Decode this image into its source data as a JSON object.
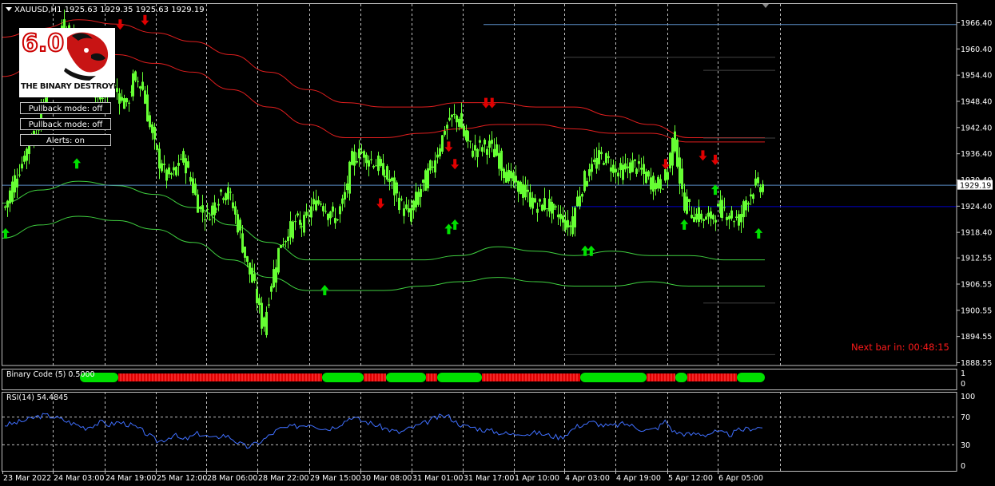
{
  "window": {
    "symbol_header": "XAUUSD,H1  1925.63 1929.35 1925.63 1929.19",
    "current_price": "1929.19"
  },
  "logo": {
    "version": "6.0",
    "text": "THE BINARY DESTROYER"
  },
  "buttons": [
    {
      "label": "Pullback mode: off"
    },
    {
      "label": "Pullback mode: off"
    },
    {
      "label": "Alerts: on"
    }
  ],
  "timer": {
    "label": "Next bar in: 00:48:15"
  },
  "colors": {
    "background": "#000000",
    "grid": "#c0c0c0",
    "candle": "#66ff33",
    "band_red": "#e01e1e",
    "band_green": "#3fcf3f",
    "rsi": "#3f6fff",
    "bid_line": "#5a8ec8",
    "hline": "#0000cc",
    "arrow_up": "#00e000",
    "arrow_down": "#e00000",
    "binary_green": "#00e000",
    "binary_red": "#e00000"
  },
  "chart_data": [
    {
      "type": "line",
      "title": "XAUUSD,H1",
      "subtitle": "1925.63 1929.35 1925.63 1929.19",
      "y_ticks": [
        "1966.40",
        "1960.40",
        "1954.40",
        "1948.40",
        "1942.40",
        "1936.40",
        "1930.40",
        "1924.40",
        "1918.40",
        "1912.55",
        "1906.55",
        "1900.55",
        "1894.55",
        "1888.55"
      ],
      "ylim": [
        1888.55,
        1968.0
      ],
      "x_ticks": [
        "23 Mar 2022",
        "24 Mar 03:00",
        "24 Mar 19:00",
        "25 Mar 12:00",
        "28 Mar 06:00",
        "28 Mar 22:00",
        "29 Mar 15:00",
        "30 Mar 08:00",
        "31 Mar 01:00",
        "31 Mar 17:00",
        "1 Apr 10:00",
        "4 Apr 03:00",
        "4 Apr 19:00",
        "5 Apr 12:00",
        "6 Apr 05:00"
      ],
      "grid": true,
      "price_path": [
        [
          0,
          1924
        ],
        [
          1,
          1930
        ],
        [
          2,
          1934
        ],
        [
          3,
          1939
        ],
        [
          4,
          1943
        ],
        [
          5,
          1950
        ],
        [
          6,
          1958
        ],
        [
          7,
          1966
        ],
        [
          8,
          1963
        ],
        [
          9,
          1960
        ],
        [
          10,
          1955
        ],
        [
          11,
          1951
        ],
        [
          12,
          1948
        ],
        [
          13,
          1953
        ],
        [
          14,
          1950
        ],
        [
          15,
          1947
        ],
        [
          16,
          1954
        ],
        [
          17,
          1952
        ],
        [
          18,
          1942
        ],
        [
          19,
          1935
        ],
        [
          20,
          1931
        ],
        [
          21,
          1932
        ],
        [
          22,
          1936
        ],
        [
          23,
          1930
        ],
        [
          24,
          1924
        ],
        [
          25,
          1922
        ],
        [
          26,
          1925
        ],
        [
          27,
          1928
        ],
        [
          28,
          1926
        ],
        [
          29,
          1919
        ],
        [
          30,
          1911
        ],
        [
          31,
          1905
        ],
        [
          32,
          1896
        ],
        [
          33,
          1907
        ],
        [
          34,
          1915
        ],
        [
          35,
          1918
        ],
        [
          36,
          1921
        ],
        [
          37,
          1920
        ],
        [
          38,
          1924
        ],
        [
          39,
          1926
        ],
        [
          40,
          1923
        ],
        [
          41,
          1921
        ],
        [
          42,
          1926
        ],
        [
          43,
          1935
        ],
        [
          44,
          1937
        ],
        [
          45,
          1935
        ],
        [
          46,
          1934
        ],
        [
          47,
          1932
        ],
        [
          48,
          1929
        ],
        [
          49,
          1925
        ],
        [
          50,
          1922
        ],
        [
          51,
          1926
        ],
        [
          52,
          1930
        ],
        [
          53,
          1934
        ],
        [
          54,
          1939
        ],
        [
          55,
          1944
        ],
        [
          56,
          1945
        ],
        [
          57,
          1940
        ],
        [
          58,
          1937
        ],
        [
          59,
          1938
        ],
        [
          60,
          1938
        ],
        [
          61,
          1936
        ],
        [
          62,
          1932
        ],
        [
          63,
          1930
        ],
        [
          64,
          1928
        ],
        [
          65,
          1926
        ],
        [
          66,
          1924
        ],
        [
          67,
          1925
        ],
        [
          68,
          1923
        ],
        [
          69,
          1922
        ],
        [
          70,
          1919
        ],
        [
          71,
          1926
        ],
        [
          72,
          1931
        ],
        [
          73,
          1934
        ],
        [
          74,
          1936
        ],
        [
          75,
          1934
        ],
        [
          76,
          1932
        ],
        [
          77,
          1933
        ],
        [
          78,
          1934
        ],
        [
          79,
          1932
        ],
        [
          80,
          1930
        ],
        [
          81,
          1929
        ],
        [
          82,
          1931
        ],
        [
          83,
          1941
        ],
        [
          84,
          1926
        ],
        [
          85,
          1923
        ],
        [
          86,
          1922
        ],
        [
          87,
          1921
        ],
        [
          88,
          1923
        ],
        [
          89,
          1924
        ],
        [
          90,
          1922
        ],
        [
          91,
          1921
        ],
        [
          92,
          1926
        ],
        [
          93,
          1929
        ],
        [
          94,
          1929
        ]
      ],
      "series": [
        {
          "values": [
            1963,
            1965,
            1967,
            1966,
            1964,
            1962,
            1959,
            1955,
            1951,
            1948,
            1947,
            1947,
            1948,
            1948,
            1947,
            1947,
            1945,
            1943,
            1940,
            1940,
            1940
          ]
        },
        {
          "values": [
            1954,
            1957,
            1959,
            1959,
            1957,
            1955,
            1951,
            1947,
            1943,
            1940,
            1940,
            1941,
            1942,
            1943,
            1943,
            1942,
            1941,
            1941,
            1939,
            1939,
            1939
          ]
        },
        {
          "values": [
            1925,
            1928,
            1930,
            1929,
            1927,
            1924,
            1920,
            1916,
            1912,
            1912,
            1912,
            1912,
            1913,
            1915,
            1914,
            1913,
            1914,
            1913,
            1913,
            1912,
            1912
          ]
        },
        {
          "values": [
            1917,
            1920,
            1922,
            1921,
            1919,
            1916,
            1912,
            1908,
            1905,
            1905,
            1905,
            1906,
            1907,
            1908,
            1907,
            1906,
            1906,
            1907,
            1906,
            1906,
            1906
          ]
        }
      ],
      "levels": {
        "bid": 1929.19,
        "blue_level": 1924.3,
        "top_line": 1966.0
      },
      "buy_arrows": [
        [
          0.5,
          1918
        ],
        [
          12,
          1934
        ],
        [
          52,
          1905
        ],
        [
          72,
          1919
        ],
        [
          73,
          1920
        ],
        [
          94,
          1914
        ],
        [
          95,
          1914
        ],
        [
          110,
          1920
        ],
        [
          115,
          1928
        ],
        [
          122,
          1918
        ]
      ],
      "sell_arrows": [
        [
          19,
          1966
        ],
        [
          23,
          1967
        ],
        [
          61,
          1925
        ],
        [
          72,
          1938
        ],
        [
          73,
          1934
        ],
        [
          78,
          1948
        ],
        [
          79,
          1948
        ],
        [
          107,
          1934
        ],
        [
          113,
          1936
        ],
        [
          115,
          1935
        ]
      ]
    },
    {
      "type": "area",
      "title": "Binary Code (5) 0.5000",
      "y_ticks": [
        "1",
        "0"
      ],
      "ylim": [
        0,
        1
      ],
      "series": [
        {
          "name": "green",
          "values": [
            [
              100,
              148
            ],
            [
              403,
              455
            ],
            [
              483,
              533
            ],
            [
              547,
              603
            ],
            [
              726,
              809
            ],
            [
              845,
              860
            ],
            [
              922,
              957
            ]
          ]
        },
        {
          "name": "red",
          "values": [
            [
              148,
              403
            ],
            [
              455,
              483
            ],
            [
              533,
              547
            ],
            [
              603,
              726
            ],
            [
              809,
              845
            ],
            [
              860,
              922
            ]
          ]
        }
      ]
    },
    {
      "type": "line",
      "title": "RSI(14) 54.4845",
      "y_ticks": [
        "100",
        "70",
        "30",
        "0"
      ],
      "ylim": [
        0,
        100
      ],
      "levels": [
        70,
        30
      ],
      "rsi_path": [
        [
          0,
          58
        ],
        [
          1,
          60
        ],
        [
          2,
          63
        ],
        [
          3,
          66
        ],
        [
          4,
          70
        ],
        [
          5,
          72
        ],
        [
          6,
          70
        ],
        [
          7,
          66
        ],
        [
          8,
          62
        ],
        [
          9,
          58
        ],
        [
          10,
          54
        ],
        [
          11,
          58
        ],
        [
          12,
          62
        ],
        [
          13,
          58
        ],
        [
          14,
          62
        ],
        [
          15,
          60
        ],
        [
          16,
          56
        ],
        [
          17,
          50
        ],
        [
          18,
          42
        ],
        [
          19,
          34
        ],
        [
          20,
          38
        ],
        [
          21,
          44
        ],
        [
          22,
          36
        ],
        [
          23,
          40
        ],
        [
          24,
          46
        ],
        [
          25,
          42
        ],
        [
          26,
          38
        ],
        [
          27,
          44
        ],
        [
          28,
          40
        ],
        [
          29,
          32
        ],
        [
          30,
          26
        ],
        [
          31,
          30
        ],
        [
          32,
          36
        ],
        [
          33,
          44
        ],
        [
          34,
          52
        ],
        [
          35,
          54
        ],
        [
          36,
          56
        ],
        [
          37,
          58
        ],
        [
          38,
          60
        ],
        [
          39,
          55
        ],
        [
          40,
          52
        ],
        [
          41,
          56
        ],
        [
          42,
          62
        ],
        [
          43,
          70
        ],
        [
          44,
          65
        ],
        [
          45,
          62
        ],
        [
          46,
          58
        ],
        [
          47,
          54
        ],
        [
          48,
          50
        ],
        [
          49,
          47
        ],
        [
          50,
          52
        ],
        [
          51,
          56
        ],
        [
          52,
          60
        ],
        [
          53,
          66
        ],
        [
          54,
          70
        ],
        [
          55,
          71
        ],
        [
          56,
          62
        ],
        [
          57,
          56
        ],
        [
          58,
          55
        ],
        [
          59,
          52
        ],
        [
          60,
          50
        ],
        [
          61,
          48
        ],
        [
          62,
          46
        ],
        [
          63,
          44
        ],
        [
          64,
          47
        ],
        [
          65,
          45
        ],
        [
          66,
          47
        ],
        [
          67,
          44
        ],
        [
          68,
          42
        ],
        [
          69,
          40
        ],
        [
          70,
          48
        ],
        [
          71,
          56
        ],
        [
          72,
          60
        ],
        [
          73,
          62
        ],
        [
          74,
          58
        ],
        [
          75,
          56
        ],
        [
          76,
          58
        ],
        [
          77,
          60
        ],
        [
          78,
          56
        ],
        [
          79,
          52
        ],
        [
          80,
          50
        ],
        [
          81,
          54
        ],
        [
          82,
          64
        ],
        [
          83,
          48
        ],
        [
          84,
          46
        ],
        [
          85,
          44
        ],
        [
          86,
          46
        ],
        [
          87,
          44
        ],
        [
          88,
          48
        ],
        [
          89,
          46
        ],
        [
          90,
          44
        ],
        [
          91,
          50
        ],
        [
          92,
          52
        ],
        [
          93,
          54
        ],
        [
          94,
          54.48
        ]
      ]
    }
  ]
}
